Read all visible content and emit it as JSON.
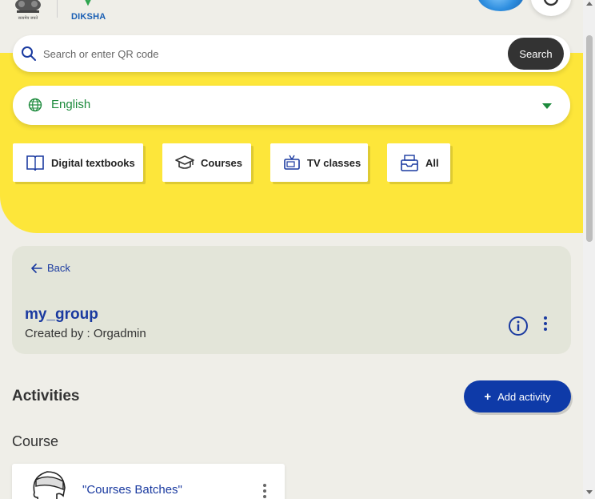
{
  "header": {
    "brand": "DIKSHA",
    "emblem_caption": "सत्यमेव जयते"
  },
  "search": {
    "placeholder": "Search or enter QR code",
    "button_label": "Search"
  },
  "language": {
    "selected": "English"
  },
  "categories": [
    {
      "label": "Digital textbooks",
      "icon": "book-icon"
    },
    {
      "label": "Courses",
      "icon": "graduation-cap-icon"
    },
    {
      "label": "TV classes",
      "icon": "tv-icon"
    },
    {
      "label": "All",
      "icon": "inbox-icon"
    }
  ],
  "group": {
    "back_label": "Back",
    "name": "my_group",
    "created_by": "Created by : Orgadmin"
  },
  "activities": {
    "title": "Activities",
    "add_label": "Add activity",
    "section_title": "Course",
    "items": [
      {
        "name": "\"Courses Batches\""
      }
    ]
  },
  "colors": {
    "accent_yellow": "#fde63a",
    "primary_blue": "#0e3aa8",
    "link_blue": "#1a3aa0",
    "language_green": "#1c8a3c",
    "card_bg": "#e3e5d9"
  }
}
